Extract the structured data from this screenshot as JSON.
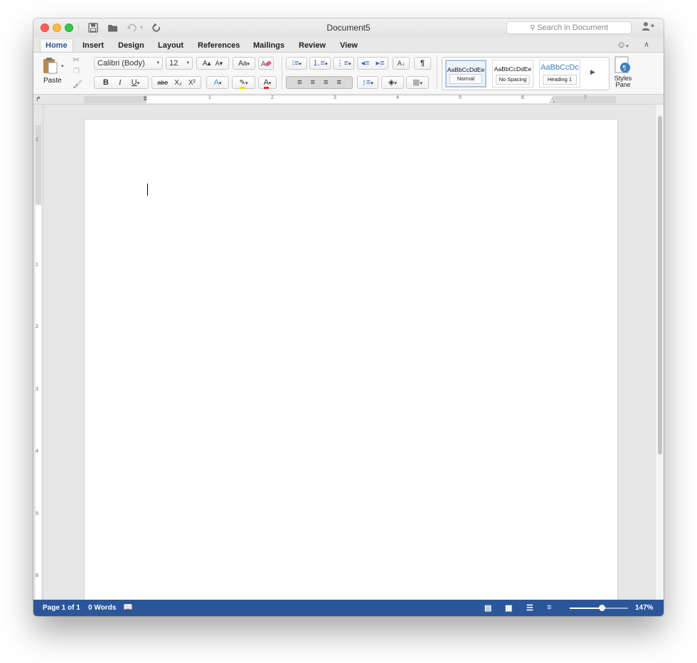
{
  "window": {
    "title": "Document5",
    "search_placeholder": "Search in Document"
  },
  "quick_access": {
    "save_icon": "floppy-disk-icon",
    "open_icon": "folder-icon",
    "undo_icon": "undo-icon",
    "redo_icon": "redo-icon"
  },
  "tabs": [
    "Home",
    "Insert",
    "Design",
    "Layout",
    "References",
    "Mailings",
    "Review",
    "View"
  ],
  "active_tab": "Home",
  "ribbon": {
    "paste_label": "Paste",
    "font_name": "Calibri (Body)",
    "font_size": "12",
    "bold": "B",
    "italic": "I",
    "underline": "U",
    "strike": "abe",
    "subscript": "X₂",
    "superscript": "X²",
    "grow_font": "A▴",
    "shrink_font": "A▾",
    "change_case": "Aa",
    "font_color_letter": "A",
    "pilcrow": "¶",
    "sort": "A↓",
    "styles": [
      {
        "sample": "AaBbCcDdEe",
        "label": "Normal"
      },
      {
        "sample": "AaBbCcDdEe",
        "label": "No Spacing"
      },
      {
        "sample": "AaBbCcDc",
        "label": "Heading 1"
      }
    ],
    "styles_pane_label_1": "Styles",
    "styles_pane_label_2": "Pane"
  },
  "ruler": {
    "h_numbers": [
      "1",
      "2",
      "3",
      "4",
      "5",
      "6",
      "7"
    ],
    "v_numbers": [
      "1",
      "1",
      "2",
      "3",
      "4",
      "5",
      "6"
    ]
  },
  "statusbar": {
    "page": "Page 1 of 1",
    "words": "0 Words",
    "zoom": "147%",
    "zoom_fraction": 0.56
  },
  "colors": {
    "status_blue": "#2b579a",
    "accent": "#2b5797",
    "highlight_yellow": "#f5e100",
    "font_red": "#e02b20"
  }
}
